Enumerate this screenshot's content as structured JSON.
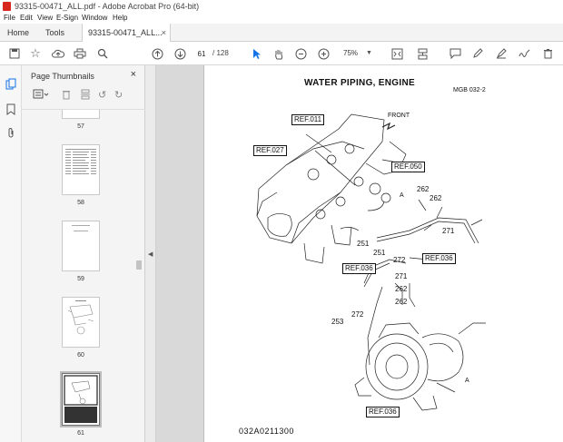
{
  "window": {
    "title": "93315-00471_ALL.pdf - Adobe Acrobat Pro (64-bit)"
  },
  "menu": [
    "File",
    "Edit",
    "View",
    "E-Sign",
    "Window",
    "Help"
  ],
  "tabs": {
    "home": "Home",
    "tools": "Tools",
    "document": "93315-00471_ALL...",
    "close_glyph": "×"
  },
  "toolbar": {
    "current_page": "61",
    "page_total": "/ 128",
    "zoom": "75%",
    "icons": [
      "save-icon",
      "bookmark-star-icon",
      "upload-icon",
      "print-icon",
      "search-icon",
      "page-up-icon",
      "page-down-icon",
      "select-arrow-icon",
      "hand-icon",
      "zoom-out-icon",
      "zoom-in-icon",
      "zoom-dropdown",
      "fit-page-icon",
      "scroll-mode-icon",
      "comment-icon",
      "pen-icon",
      "highlight-icon",
      "sign-icon",
      "delete-icon"
    ]
  },
  "panel": {
    "title": "Page Thumbnails",
    "close_glyph": "×",
    "thumbnails": [
      {
        "label": "57"
      },
      {
        "label": "58"
      },
      {
        "label": "59"
      },
      {
        "label": "60"
      },
      {
        "label": "61"
      }
    ]
  },
  "page": {
    "title": "WATER  PIPING, ENGINE",
    "code": "MGB 032-2",
    "front": "FRONT",
    "refs": [
      "REF.011",
      "REF.027",
      "REF.050",
      "REF.036",
      "REF.036",
      "REF.036"
    ],
    "parts": [
      "262",
      "262",
      "271",
      "251",
      "251",
      "272",
      "271",
      "262",
      "262",
      "253",
      "272"
    ],
    "markers": [
      "A",
      "A"
    ],
    "figure_id": "032A0211300"
  },
  "colors": {
    "selection": "#bcbcbc",
    "canvas": "#d9d9d9",
    "brand_red": "#d7271d"
  }
}
